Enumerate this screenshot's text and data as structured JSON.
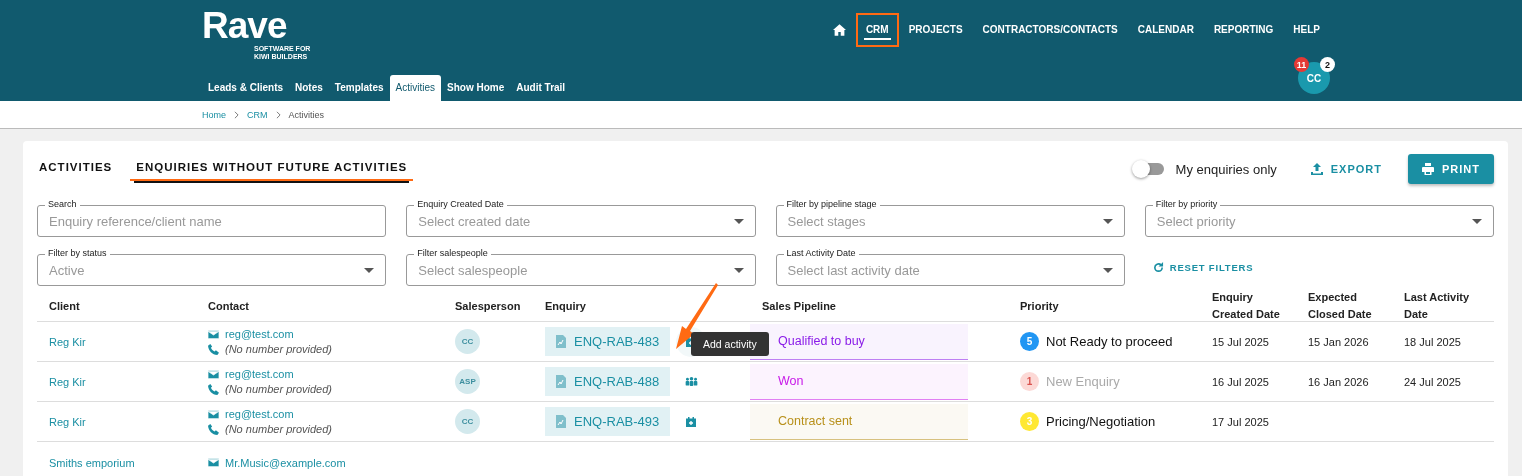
{
  "logo": {
    "name": "Rave",
    "tagline": "SOFTWARE FOR KIWI BUILDERS"
  },
  "top_nav": [
    {
      "label": "CRM",
      "selected": true,
      "annotated": true
    },
    {
      "label": "PROJECTS",
      "selected": false,
      "annotated": false
    },
    {
      "label": "CONTRACTORS/CONTACTS",
      "selected": false,
      "annotated": false
    },
    {
      "label": "CALENDAR",
      "selected": false,
      "annotated": false
    },
    {
      "label": "REPORTING",
      "selected": false,
      "annotated": false
    },
    {
      "label": "HELP",
      "selected": false,
      "annotated": false
    }
  ],
  "sub_tabs": [
    {
      "label": "Leads & Clients",
      "selected": false
    },
    {
      "label": "Notes",
      "selected": false
    },
    {
      "label": "Templates",
      "selected": false
    },
    {
      "label": "Activities",
      "selected": true
    },
    {
      "label": "Show Home",
      "selected": false
    },
    {
      "label": "Audit Trail",
      "selected": false
    }
  ],
  "user": {
    "initials": "CC",
    "alerts_badge": "11",
    "messages_badge": "2"
  },
  "breadcrumb": [
    {
      "label": "Home",
      "link": true
    },
    {
      "label": "CRM",
      "link": true
    },
    {
      "label": "Activities",
      "link": false
    }
  ],
  "page_tabs": [
    {
      "label": "ACTIVITIES",
      "selected": false
    },
    {
      "label": "ENQUIRIES WITHOUT FUTURE ACTIVITIES",
      "selected": true
    }
  ],
  "my_enquiries_toggle": {
    "label": "My enquiries only",
    "on": false
  },
  "export_button": "EXPORT",
  "print_button": "PRINT",
  "filters": [
    {
      "label": "Search",
      "placeholder": "Enquiry reference/client name",
      "kind": "text"
    },
    {
      "label": "Enquiry Created Date",
      "placeholder": "Select created date",
      "kind": "select"
    },
    {
      "label": "Filter by pipeline stage",
      "placeholder": "Select stages",
      "kind": "select"
    },
    {
      "label": "Filter by priority",
      "placeholder": "Select priority",
      "kind": "select"
    },
    {
      "label": "Filter by status",
      "placeholder": "Active",
      "kind": "select"
    },
    {
      "label": "Filter salespeople",
      "placeholder": "Select salespeople",
      "kind": "select"
    },
    {
      "label": "Last Activity Date",
      "placeholder": "Select last activity date",
      "kind": "select"
    }
  ],
  "reset_filters": "RESET FILTERS",
  "table": {
    "columns": [
      "Client",
      "Contact",
      "Salesperson",
      "Enquiry",
      "Sales Pipeline",
      "Priority",
      "Enquiry Created Date",
      "Expected Closed Date",
      "Last Activity Date"
    ],
    "rows": [
      {
        "client": "Reg Kir",
        "email": "reg@test.com",
        "phone": "(No number provided)",
        "salesperson": "CC",
        "enquiry": "ENQ-RAB-483",
        "action": {
          "kind": "calendar",
          "hovered": true,
          "tooltip": "Add activity"
        },
        "pipeline": {
          "stage": "Qualified to buy",
          "color": "#8a1be8"
        },
        "priority": {
          "number": "5",
          "label": "Not Ready to proceed",
          "color": "#2196f3",
          "muted": false
        },
        "created": "15 Jul 2025",
        "expected": "15 Jan 2026",
        "last_activity": "18 Jul 2025"
      },
      {
        "client": "Reg Kir",
        "email": "reg@test.com",
        "phone": "(No number provided)",
        "salesperson": "ASP",
        "enquiry": "ENQ-RAB-488",
        "action": {
          "kind": "people",
          "hovered": false
        },
        "pipeline": {
          "stage": "Won",
          "color": "#c81be8"
        },
        "priority": {
          "number": "1",
          "label": "New Enquiry",
          "color": "#fcd9d6",
          "muted": true
        },
        "created": "16 Jul 2025",
        "expected": "16 Jan 2026",
        "last_activity": "24 Jul 2025"
      },
      {
        "client": "Reg Kir",
        "email": "reg@test.com",
        "phone": "(No number provided)",
        "salesperson": "CC",
        "enquiry": "ENQ-RAB-493",
        "action": {
          "kind": "calendar",
          "hovered": false
        },
        "pipeline": {
          "stage": "Contract sent",
          "color": "#b8901a"
        },
        "priority": {
          "number": "3",
          "label": "Pricing/Negotiation",
          "color": "#ffe833",
          "muted": false
        },
        "created": "17 Jul 2025"
      },
      {
        "client": "Smiths emporium",
        "email": "Mr.Music@example.com"
      }
    ]
  }
}
